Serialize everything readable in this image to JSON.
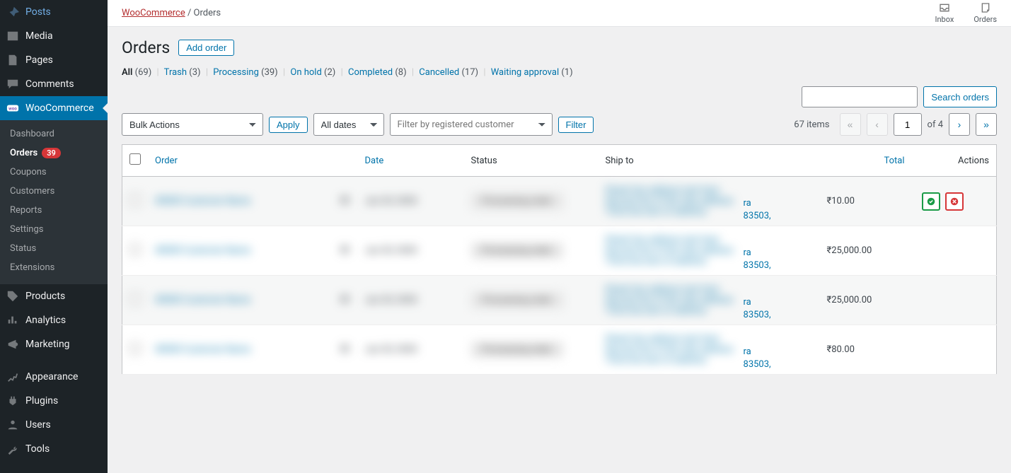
{
  "sidebar": {
    "items": [
      {
        "name": "posts",
        "label": "Posts"
      },
      {
        "name": "media",
        "label": "Media"
      },
      {
        "name": "pages",
        "label": "Pages"
      },
      {
        "name": "comments",
        "label": "Comments"
      },
      {
        "name": "woocommerce",
        "label": "WooCommerce"
      },
      {
        "name": "products",
        "label": "Products"
      },
      {
        "name": "analytics",
        "label": "Analytics"
      },
      {
        "name": "marketing",
        "label": "Marketing"
      },
      {
        "name": "appearance",
        "label": "Appearance"
      },
      {
        "name": "plugins",
        "label": "Plugins"
      },
      {
        "name": "users",
        "label": "Users"
      },
      {
        "name": "tools",
        "label": "Tools"
      }
    ],
    "submenu": [
      {
        "name": "dashboard",
        "label": "Dashboard"
      },
      {
        "name": "orders",
        "label": "Orders",
        "badge": "39"
      },
      {
        "name": "coupons",
        "label": "Coupons"
      },
      {
        "name": "customers",
        "label": "Customers"
      },
      {
        "name": "reports",
        "label": "Reports"
      },
      {
        "name": "settings",
        "label": "Settings"
      },
      {
        "name": "status",
        "label": "Status"
      },
      {
        "name": "extensions",
        "label": "Extensions"
      }
    ]
  },
  "breadcrumb": {
    "parent": "WooCommerce",
    "current": "Orders"
  },
  "top_icons": {
    "inbox": "Inbox",
    "orders": "Orders"
  },
  "page": {
    "title": "Orders",
    "add_button": "Add order"
  },
  "filters": [
    {
      "name": "all",
      "label": "All",
      "count": "(69)",
      "current": true
    },
    {
      "name": "trash",
      "label": "Trash",
      "count": "(3)"
    },
    {
      "name": "processing",
      "label": "Processing",
      "count": "(39)"
    },
    {
      "name": "on-hold",
      "label": "On hold",
      "count": "(2)"
    },
    {
      "name": "completed",
      "label": "Completed",
      "count": "(8)"
    },
    {
      "name": "cancelled",
      "label": "Cancelled",
      "count": "(17)"
    },
    {
      "name": "waiting-approval",
      "label": "Waiting approval",
      "count": "(1)"
    }
  ],
  "controls": {
    "bulk_actions": "Bulk Actions",
    "apply": "Apply",
    "date_filter": "All dates",
    "customer_filter": "Filter by registered customer",
    "filter_button": "Filter",
    "search_button": "Search orders",
    "items_count": "67 items",
    "page_current": "1",
    "page_total": "of 4"
  },
  "columns": {
    "order": "Order",
    "date": "Date",
    "status": "Status",
    "shipto": "Ship to",
    "total": "Total",
    "actions": "Actions"
  },
  "rows": [
    {
      "ship_visible_1": "ra",
      "ship_visible_2": "83503,",
      "total": "₹10.00",
      "has_actions": true
    },
    {
      "ship_visible_1": "ra",
      "ship_visible_2": "83503,",
      "total": "₹25,000.00",
      "has_actions": false
    },
    {
      "ship_visible_1": "ra",
      "ship_visible_2": "83503,",
      "total": "₹25,000.00",
      "has_actions": false
    },
    {
      "ship_visible_1": "ra",
      "ship_visible_2": "83503,",
      "total": "₹80.00",
      "has_actions": false
    }
  ]
}
